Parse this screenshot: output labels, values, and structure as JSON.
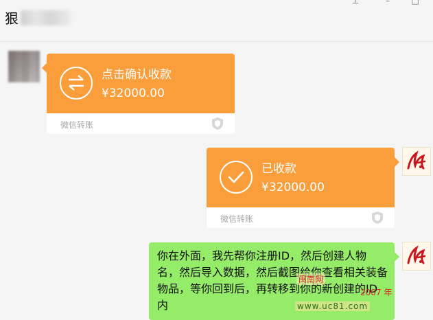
{
  "header": {
    "title": "狠"
  },
  "messages": {
    "transfer_received": {
      "status": "点击确认收款",
      "amount": "¥32000.00",
      "brand": "微信转账",
      "bg_color": "#fa9d3b"
    },
    "transfer_confirmed": {
      "status": "已收款",
      "amount": "¥32000.00",
      "brand": "微信转账",
      "bg_color": "#fa9d3b"
    },
    "text_message": {
      "text": "你在外面，我先帮你注册ID，然后创建人物名，然后导入数据，然后截图给你查看相关装备物品，等你回到后，再转移到你的新创建的ID内",
      "bg_color": "#95ec69"
    }
  },
  "watermark": {
    "top": "闽南网",
    "year": "2007 年",
    "url": "www.uc81.com"
  },
  "icons": {
    "transfer": "transfer-arrows-icon",
    "confirmed": "checkmark-icon",
    "security": "shield-icon"
  }
}
